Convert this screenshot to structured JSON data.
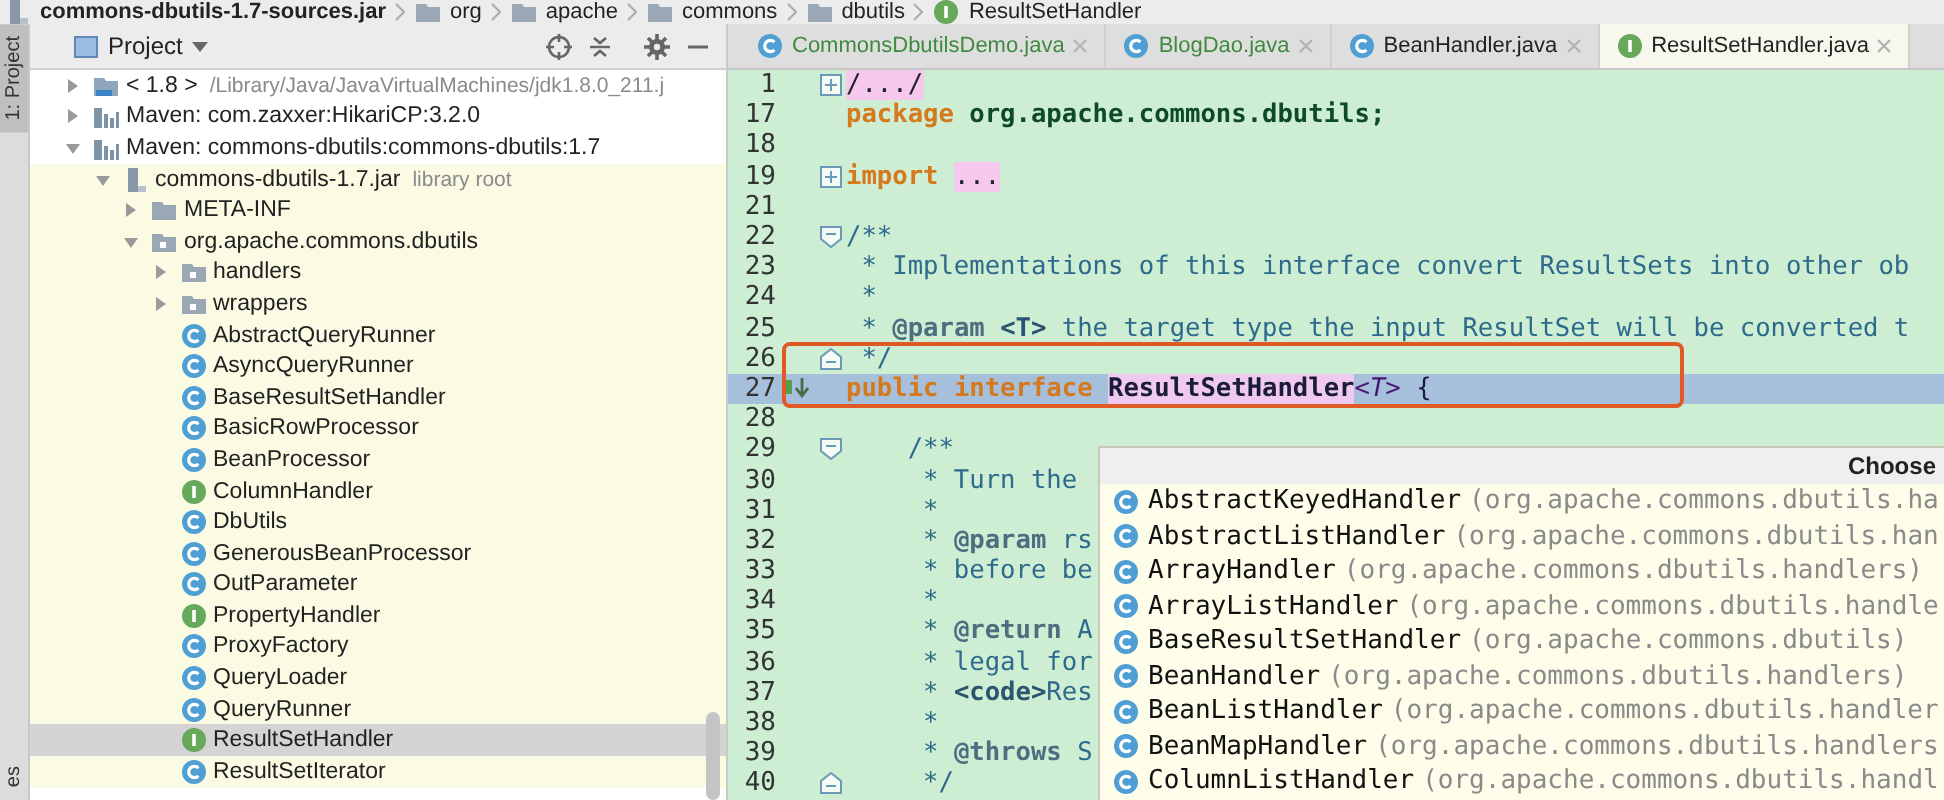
{
  "breadcrumb": [
    {
      "label": "commons-dbutils-1.7-sources.jar",
      "kind": "jar"
    },
    {
      "label": "org",
      "kind": "folder"
    },
    {
      "label": "apache",
      "kind": "folder"
    },
    {
      "label": "commons",
      "kind": "folder"
    },
    {
      "label": "dbutils",
      "kind": "folder"
    },
    {
      "label": "ResultSetHandler",
      "kind": "interface"
    }
  ],
  "tool_strip": [
    {
      "label": "1: Project",
      "selected": true
    },
    {
      "label": "es",
      "selected": false
    }
  ],
  "project_panel": {
    "title": "Project",
    "tree": [
      {
        "label": "< 1.8 >",
        "detail": "/Library/Java/JavaVirtualMachines/jdk1.8.0_211.j",
        "kind": "sdk",
        "expanded": false,
        "selected": false
      },
      {
        "label": "Maven: com.zaxxer:HikariCP:3.2.0",
        "kind": "library",
        "expanded": false,
        "selected": false
      },
      {
        "label": "Maven: commons-dbutils:commons-dbutils:1.7",
        "kind": "library",
        "expanded": true,
        "selected": false,
        "children": [
          {
            "label": "commons-dbutils-1.7.jar",
            "detail": "library root",
            "kind": "jar",
            "expanded": true,
            "selected": false,
            "children": [
              {
                "label": "META-INF",
                "kind": "folder",
                "expanded": false,
                "selected": false
              },
              {
                "label": "org.apache.commons.dbutils",
                "kind": "package",
                "expanded": true,
                "selected": false,
                "children": [
                  {
                    "label": "handlers",
                    "kind": "package",
                    "expanded": false,
                    "selected": false
                  },
                  {
                    "label": "wrappers",
                    "kind": "package",
                    "expanded": false,
                    "selected": false
                  },
                  {
                    "label": "AbstractQueryRunner",
                    "kind": "class",
                    "selected": false
                  },
                  {
                    "label": "AsyncQueryRunner",
                    "kind": "class",
                    "selected": false
                  },
                  {
                    "label": "BaseResultSetHandler",
                    "kind": "class",
                    "selected": false
                  },
                  {
                    "label": "BasicRowProcessor",
                    "kind": "class",
                    "selected": false
                  },
                  {
                    "label": "BeanProcessor",
                    "kind": "class",
                    "selected": false
                  },
                  {
                    "label": "ColumnHandler",
                    "kind": "interface",
                    "selected": false
                  },
                  {
                    "label": "DbUtils",
                    "kind": "class",
                    "selected": false
                  },
                  {
                    "label": "GenerousBeanProcessor",
                    "kind": "class",
                    "selected": false
                  },
                  {
                    "label": "OutParameter",
                    "kind": "class",
                    "selected": false
                  },
                  {
                    "label": "PropertyHandler",
                    "kind": "interface",
                    "selected": false
                  },
                  {
                    "label": "ProxyFactory",
                    "kind": "class",
                    "selected": false
                  },
                  {
                    "label": "QueryLoader",
                    "kind": "class",
                    "selected": false
                  },
                  {
                    "label": "QueryRunner",
                    "kind": "class",
                    "selected": false
                  },
                  {
                    "label": "ResultSetHandler",
                    "kind": "interface",
                    "selected": true
                  },
                  {
                    "label": "ResultSetIterator",
                    "kind": "class",
                    "selected": false
                  }
                ]
              }
            ]
          }
        ]
      }
    ]
  },
  "editor": {
    "tabs": [
      {
        "label": "CommonsDbutilsDemo.java",
        "kind": "class",
        "color": "#3f8a3f",
        "selected": false
      },
      {
        "label": "BlogDao.java",
        "kind": "class",
        "color": "#3f8a3f",
        "selected": false
      },
      {
        "label": "BeanHandler.java",
        "kind": "class",
        "color": "#222222",
        "selected": false
      },
      {
        "label": "ResultSetHandler.java",
        "kind": "interface",
        "color": "#222222",
        "selected": true
      }
    ],
    "lines": [
      {
        "number": "1",
        "folded": true,
        "current": false,
        "boxed": false,
        "tokens": [
          {
            "kind": "folded",
            "text": "/.../"
          }
        ]
      },
      {
        "number": "17",
        "current": false,
        "boxed": false,
        "tokens": [
          {
            "kind": "keyword",
            "text": "package"
          },
          {
            "kind": "package",
            "text": " org.apache.commons.dbutils;"
          }
        ]
      },
      {
        "number": "18",
        "current": false,
        "boxed": false
      },
      {
        "number": "19",
        "folded": true,
        "current": false,
        "boxed": false,
        "tokens": [
          {
            "kind": "keyword",
            "text": "import "
          },
          {
            "kind": "folded",
            "text": "..."
          }
        ]
      },
      {
        "number": "21",
        "current": false,
        "boxed": false
      },
      {
        "number": "22",
        "fold_start": true,
        "current": false,
        "boxed": false,
        "tokens": [
          {
            "kind": "doc",
            "text": "/**"
          }
        ]
      },
      {
        "number": "23",
        "current": false,
        "boxed": false,
        "tokens": [
          {
            "kind": "doc",
            "text": " * Implementations of this interface convert ResultSets into other ob"
          }
        ]
      },
      {
        "number": "24",
        "current": false,
        "boxed": false,
        "tokens": [
          {
            "kind": "doc",
            "text": " *"
          }
        ]
      },
      {
        "number": "25",
        "current": false,
        "boxed": false,
        "tokens": [
          {
            "kind": "doc",
            "text": " * "
          },
          {
            "kind": "doctag",
            "text": "@param"
          },
          {
            "kind": "docbold",
            "text": " <T>"
          },
          {
            "kind": "doc",
            "text": " the target type the input ResultSet will be converted t"
          }
        ]
      },
      {
        "number": "26",
        "fold_end": true,
        "current": false,
        "boxed": true,
        "tokens": [
          {
            "kind": "doc",
            "text": " */"
          }
        ]
      },
      {
        "number": "27",
        "implemented": true,
        "current": true,
        "boxed": true,
        "tokens": [
          {
            "kind": "keyword",
            "text": "public "
          },
          {
            "kind": "keyword",
            "text": "interface "
          },
          {
            "kind": "classname",
            "text": "ResultSetHandler"
          },
          {
            "kind": "typeparam",
            "text": "<T>"
          },
          {
            "kind": "plain",
            "text": " {"
          }
        ]
      },
      {
        "number": "28",
        "current": false,
        "boxed": false
      },
      {
        "number": "29",
        "fold_start": true,
        "current": false,
        "boxed": false,
        "tokens": [
          {
            "kind": "doc",
            "text": "    /**"
          }
        ]
      },
      {
        "number": "30",
        "current": false,
        "boxed": false,
        "tokens": [
          {
            "kind": "doc",
            "text": "     * Turn the"
          }
        ]
      },
      {
        "number": "31",
        "current": false,
        "boxed": false,
        "tokens": [
          {
            "kind": "doc",
            "text": "     *"
          }
        ]
      },
      {
        "number": "32",
        "current": false,
        "boxed": false,
        "tokens": [
          {
            "kind": "doc",
            "text": "     * "
          },
          {
            "kind": "doctag",
            "text": "@param"
          },
          {
            "kind": "doc",
            "text": " rs"
          }
        ]
      },
      {
        "number": "33",
        "current": false,
        "boxed": false,
        "tokens": [
          {
            "kind": "doc",
            "text": "     * before be"
          }
        ]
      },
      {
        "number": "34",
        "current": false,
        "boxed": false,
        "tokens": [
          {
            "kind": "doc",
            "text": "     *"
          }
        ]
      },
      {
        "number": "35",
        "current": false,
        "boxed": false,
        "tokens": [
          {
            "kind": "doc",
            "text": "     * "
          },
          {
            "kind": "doctag",
            "text": "@return"
          },
          {
            "kind": "doc",
            "text": " A"
          }
        ]
      },
      {
        "number": "36",
        "current": false,
        "boxed": false,
        "tokens": [
          {
            "kind": "doc",
            "text": "     * legal for"
          }
        ]
      },
      {
        "number": "37",
        "current": false,
        "boxed": false,
        "tokens": [
          {
            "kind": "doc",
            "text": "     * "
          },
          {
            "kind": "docbold",
            "text": "<code>"
          },
          {
            "kind": "doc",
            "text": "Res"
          }
        ]
      },
      {
        "number": "38",
        "current": false,
        "boxed": false,
        "tokens": [
          {
            "kind": "doc",
            "text": "     *"
          }
        ]
      },
      {
        "number": "39",
        "current": false,
        "boxed": false,
        "tokens": [
          {
            "kind": "doc",
            "text": "     * "
          },
          {
            "kind": "doctag",
            "text": "@throws"
          },
          {
            "kind": "doc",
            "text": " S"
          }
        ]
      },
      {
        "number": "40",
        "fold_end": true,
        "current": false,
        "boxed": false,
        "tokens": [
          {
            "kind": "doc",
            "text": "     */"
          }
        ]
      }
    ]
  },
  "popup": {
    "title": "Choose",
    "items": [
      {
        "name": "AbstractKeyedHandler",
        "package": "(org.apache.commons.dbutils.ha"
      },
      {
        "name": "AbstractListHandler",
        "package": "(org.apache.commons.dbutils.han"
      },
      {
        "name": "ArrayHandler",
        "package": "(org.apache.commons.dbutils.handlers)"
      },
      {
        "name": "ArrayListHandler",
        "package": "(org.apache.commons.dbutils.handle"
      },
      {
        "name": "BaseResultSetHandler",
        "package": "(org.apache.commons.dbutils)"
      },
      {
        "name": "BeanHandler",
        "package": "(org.apache.commons.dbutils.handlers)"
      },
      {
        "name": "BeanListHandler",
        "package": "(org.apache.commons.dbutils.handler"
      },
      {
        "name": "BeanMapHandler",
        "package": "(org.apache.commons.dbutils.handlers"
      },
      {
        "name": "ColumnListHandler",
        "package": "(org.apache.commons.dbutils.handl"
      }
    ]
  }
}
